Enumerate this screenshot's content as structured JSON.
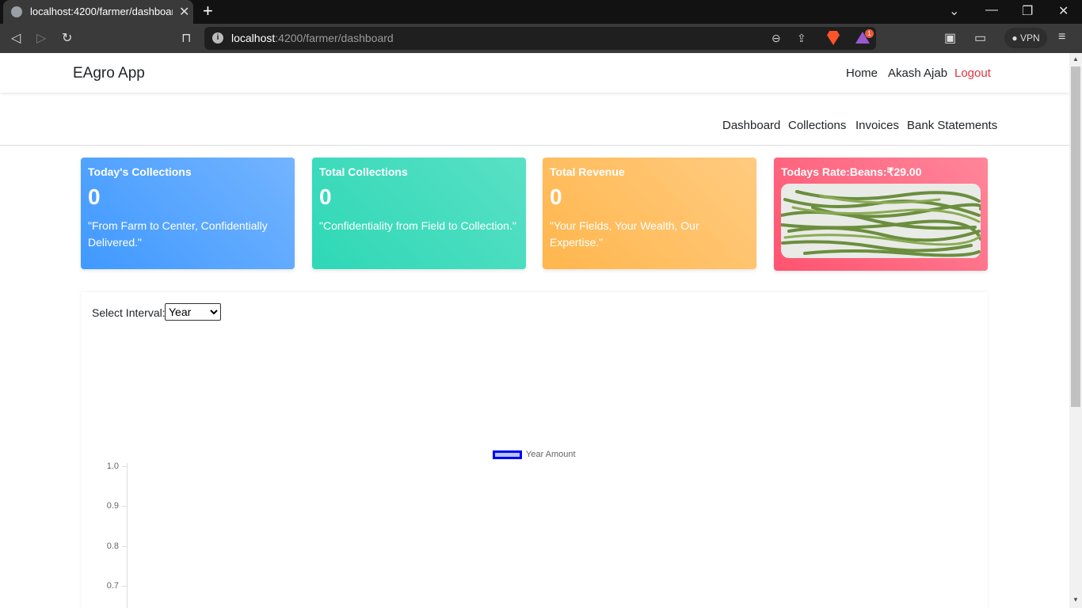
{
  "browser": {
    "tab_title": "localhost:4200/farmer/dashboard",
    "url_host": "localhost",
    "url_path": ":4200/farmer/dashboard",
    "rewards_badge": "1",
    "vpn_label": "VPN"
  },
  "navbar": {
    "brand": "EAgro App",
    "links": [
      "Home",
      "Akash Ajab"
    ],
    "logout": "Logout"
  },
  "subnav": {
    "links": [
      "Dashboard",
      "Collections",
      "Invoices",
      "Bank Statements"
    ]
  },
  "cards": [
    {
      "title": "Today's Collections",
      "value": "0",
      "quote": "\"From Farm to Center, Confidentially Delivered.\""
    },
    {
      "title": "Total Collections",
      "value": "0",
      "quote": "\"Confidentiality from Field to Collection.\""
    },
    {
      "title": "Total Revenue",
      "value": "0",
      "quote": "\"Your Fields, Your Wealth, Our Expertise.\""
    },
    {
      "title": "Todays Rate:Beans:₹29.00"
    }
  ],
  "interval": {
    "label": "Select Interval:",
    "selected": "Year"
  },
  "colors": {
    "card_blue": "#4099ff",
    "card_green": "#2ed8b6",
    "card_orange": "#ffb64d",
    "card_red": "#ff5370",
    "legend_border": "#0000ff",
    "logout": "#dc3545"
  },
  "chart_data": {
    "type": "bar",
    "categories": [],
    "series": [
      {
        "name": "Year Amount",
        "values": []
      }
    ],
    "yticks": [
      "1.0",
      "0.9",
      "0.8",
      "0.7"
    ],
    "ylim": [
      0,
      1
    ],
    "legend": "top"
  }
}
